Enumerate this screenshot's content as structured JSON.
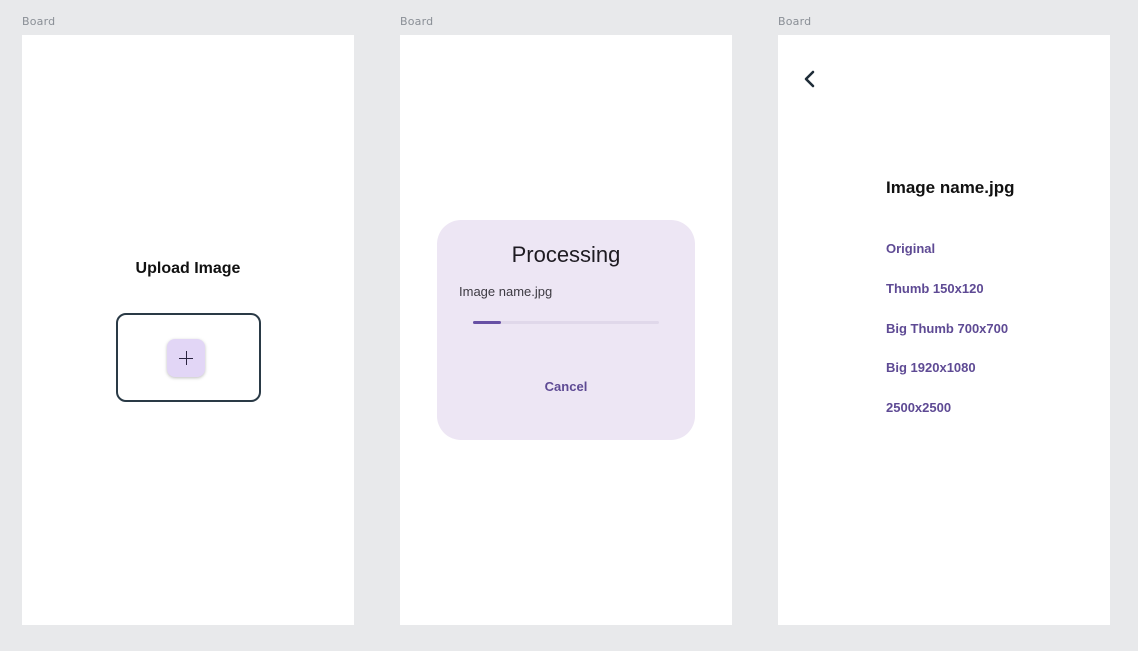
{
  "boards": [
    {
      "label": "Board"
    },
    {
      "label": "Board"
    },
    {
      "label": "Board"
    }
  ],
  "upload": {
    "title": "Upload Image",
    "add_icon": "plus-icon"
  },
  "processing": {
    "title": "Processing",
    "file_name": "Image name.jpg",
    "progress_fraction": 0.15,
    "cancel_label": "Cancel"
  },
  "result": {
    "back_icon": "chevron-left-icon",
    "file_name": "Image name.jpg",
    "sizes": [
      "Original",
      "Thumb 150x120",
      "Big Thumb 700x700",
      "Big 1920x1080",
      "2500x2500"
    ]
  },
  "colors": {
    "accent": "#6750a4",
    "link_text": "#5e4a94",
    "dialog_bg": "#ede6f4",
    "add_button_bg": "#e2d6f6",
    "upload_border": "#2a3a46"
  }
}
